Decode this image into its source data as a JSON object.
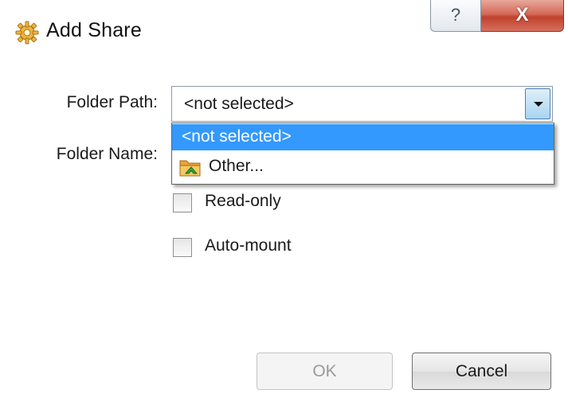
{
  "window": {
    "title": "Add Share",
    "title_icon": "gear-icon",
    "help_glyph": "?",
    "close_glyph": "X"
  },
  "form": {
    "folder_path_label": "Folder Path:",
    "folder_name_label": "Folder Name:",
    "folder_path_value": "<not selected>",
    "dropdown_items": [
      {
        "label": "<not selected>",
        "selected": true,
        "icon": ""
      },
      {
        "label": "Other...",
        "selected": false,
        "icon": "folder-icon"
      }
    ],
    "readonly_label": "Read-only",
    "readonly_checked": false,
    "automount_label": "Auto-mount",
    "automount_checked": false
  },
  "buttons": {
    "ok_label": "OK",
    "ok_enabled": false,
    "cancel_label": "Cancel"
  },
  "colors": {
    "selection": "#3399ff",
    "close_button": "#c0412d"
  }
}
